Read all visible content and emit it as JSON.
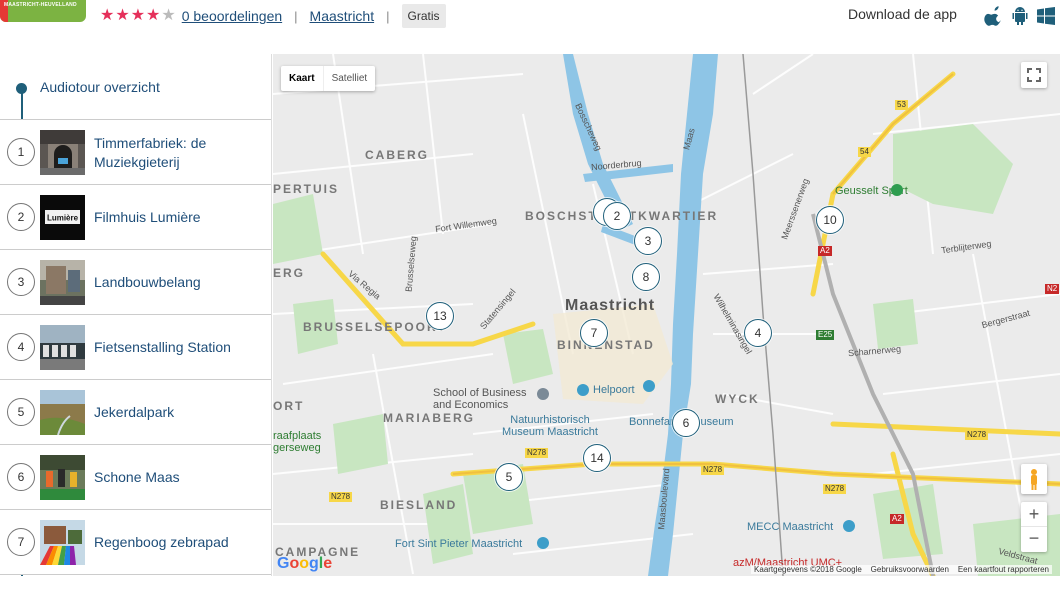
{
  "header": {
    "logo_text": "MAASTRICHT-HEUVELLAND",
    "stars_filled": 4,
    "stars_total": 5,
    "reviews_link": "0 beoordelingen",
    "separator": "|",
    "city_link": "Maastricht",
    "price_badge": "Gratis",
    "download_label": "Download de app",
    "os_icons": [
      "apple-icon",
      "android-icon",
      "windows-icon"
    ]
  },
  "sidebar": {
    "overview_label": "Audiotour overzicht",
    "stops": [
      {
        "num": "1",
        "title": "Timmerfabriek: de Muziekgieterij"
      },
      {
        "num": "2",
        "title": "Filmhuis Lumière",
        "thumb_text": "Lumière"
      },
      {
        "num": "3",
        "title": "Landbouwbelang"
      },
      {
        "num": "4",
        "title": "Fietsenstalling Station"
      },
      {
        "num": "5",
        "title": "Jekerdalpark"
      },
      {
        "num": "6",
        "title": "Schone Maas"
      },
      {
        "num": "7",
        "title": "Regenboog zebrapad"
      }
    ]
  },
  "map": {
    "toggle_map": "Kaart",
    "toggle_sat": "Satelliet",
    "zoom_in": "+",
    "zoom_out": "−",
    "fullscreen_icon": "fullscreen-icon",
    "pegman_icon": "pegman-icon",
    "footer_data": "Kaartgegevens ©2018 Google",
    "footer_terms": "Gebruiksvoorwaarden",
    "footer_report": "Een kaartfout rapporteren",
    "google_logo": "Google",
    "labels": {
      "caberg": "CABERG",
      "pertuis": "PERTUIS",
      "erg": "ERG",
      "brusselsepoort": "BRUSSELSEPOORT",
      "boschstraatkwartier": "BOSCHSTRAATKWARTIER",
      "maastricht": "Maastricht",
      "binnenstad": "BINNENSTAD",
      "wyck": "WYCK",
      "ort": "ORT",
      "mariaberg": "MARIABERG",
      "biesland": "BIESLAND",
      "campagne": "CAMPAGNE",
      "maas": "Maas",
      "noorderbrug": "Noorderbrug",
      "bosscheweg": "Bosscheweg",
      "fort_willemweg": "Fort Willemweg",
      "via_regia": "Via Regia",
      "brusselseweg": "Brusselseweg",
      "statensingel": "Statensingel",
      "wilhelminasingel": "Wilhelminasingel",
      "meerssenerweg": "Meerssenerweg",
      "terblijterweg": "Terblijterweg",
      "bergerstraat": "Bergerstraat",
      "scharnerweg": "Scharnerweg",
      "maasboulevard": "Maasboulevard",
      "veldstraat": "Veldstraat",
      "geusselt": "Geusselt Sport",
      "school": "School of Business and Economics",
      "helpoort": "Helpoort",
      "natuur": "Natuurhistorisch Museum Maastricht",
      "bonnefanten": "Bonnefantenmuseum",
      "begraafplaats": "raafplaats gerseweg",
      "mecc": "MECC Maastricht",
      "fort_sint_pieter": "Fort Sint Pieter Maastricht",
      "umc": "azM/Maastricht UMC+"
    },
    "shields": {
      "n53": "53",
      "n54": "54",
      "a2a": "A2",
      "a2b": "A2",
      "e25": "E25",
      "n278a": "N278",
      "n278b": "N278",
      "n278c": "N278",
      "n278d": "N278",
      "n278e": "N278",
      "n2": "N2"
    },
    "markers": [
      "1",
      "2",
      "3",
      "8",
      "10",
      "13",
      "7",
      "4",
      "6",
      "14",
      "5"
    ]
  },
  "colors": {
    "accent": "#1f5f7a",
    "link": "#1f4e79",
    "star": "#e5305a",
    "water": "#8ec5e6",
    "park": "#b7e0b0",
    "road_major": "#f7d748"
  }
}
